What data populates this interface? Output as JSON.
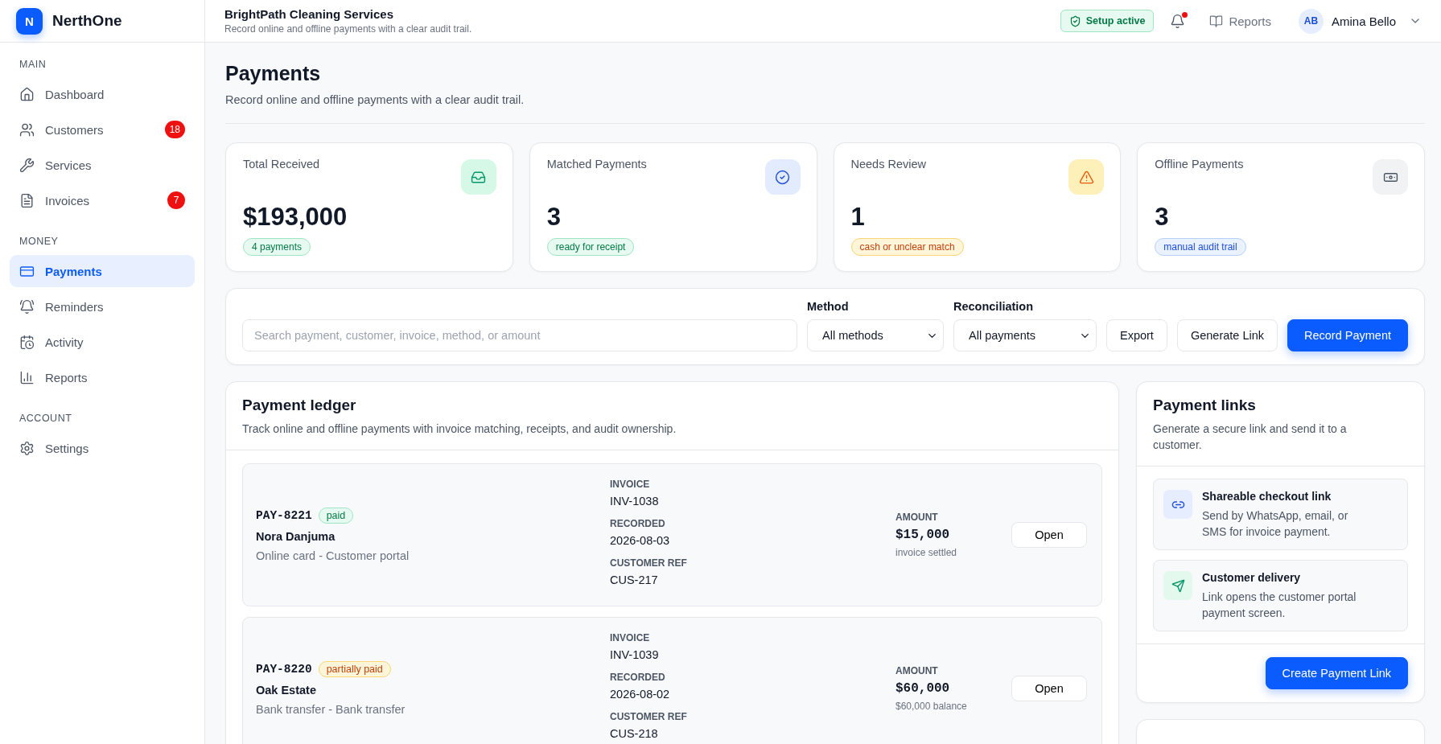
{
  "brand": {
    "logo_letter": "N",
    "name": "NerthOne"
  },
  "sidebar": {
    "sections": [
      {
        "heading": "MAIN",
        "items": [
          {
            "label": "Dashboard",
            "selected": false
          },
          {
            "label": "Customers",
            "badge": "18",
            "selected": false
          },
          {
            "label": "Services",
            "selected": false
          },
          {
            "label": "Invoices",
            "badge": "7",
            "selected": false
          }
        ]
      },
      {
        "heading": "MONEY",
        "items": [
          {
            "label": "Payments",
            "selected": true
          },
          {
            "label": "Reminders",
            "selected": false
          },
          {
            "label": "Activity",
            "selected": false
          },
          {
            "label": "Reports",
            "selected": false
          }
        ]
      },
      {
        "heading": "ACCOUNT",
        "items": [
          {
            "label": "Settings",
            "selected": false
          }
        ]
      }
    ]
  },
  "topbar": {
    "title": "BrightPath Cleaning Services",
    "subtitle": "Record online and offline payments with a clear audit trail.",
    "status_badge": "Setup active",
    "has_unread": true,
    "reports_link": "Reports",
    "user": {
      "initials": "AB",
      "name": "Amina Bello"
    }
  },
  "page": {
    "title": "Payments",
    "subtitle": "Record online and offline payments with a clear audit trail."
  },
  "stats": [
    {
      "label": "Total Received",
      "value": "$193,000",
      "tag": {
        "text": "4 payments",
        "kind": "success"
      }
    },
    {
      "label": "Matched Payments",
      "value": "3",
      "tag": {
        "text": "ready for receipt",
        "kind": "success"
      }
    },
    {
      "label": "Needs Review",
      "value": "1",
      "tag": {
        "text": "cash or unclear match",
        "kind": "warning"
      }
    },
    {
      "label": "Offline Payments",
      "value": "3",
      "tag": {
        "text": "manual audit trail",
        "kind": "info"
      }
    }
  ],
  "filters": {
    "search": {
      "placeholder": "Search payment, customer, invoice, method, or amount"
    },
    "method": {
      "label": "Method",
      "value": "All methods"
    },
    "reconciliation": {
      "label": "Reconciliation",
      "value": "All payments"
    },
    "buttons": [
      {
        "label": "Export",
        "kind": "secondary"
      },
      {
        "label": "Generate Link",
        "kind": "secondary"
      },
      {
        "label": "Record Payment",
        "kind": "primary"
      }
    ]
  },
  "ledger": {
    "title": "Payment ledger",
    "subtitle": "Track online and offline payments with invoice matching, receipts, and audit ownership.",
    "payments": [
      {
        "id": "PAY-8221",
        "status": {
          "text": "paid",
          "kind": "success"
        },
        "customer": "Nora Danjuma",
        "method": "Online card - Customer portal",
        "fields": [
          {
            "label": "INVOICE",
            "value": "INV-1038"
          },
          {
            "label": "RECORDED",
            "value": "2026-08-03"
          },
          {
            "label": "CUSTOMER REF",
            "value": "CUS-217"
          }
        ],
        "amount_label": "AMOUNT",
        "amount": "$15,000",
        "amount_note": "invoice settled",
        "action": "Open"
      },
      {
        "id": "PAY-8220",
        "status": {
          "text": "partially paid",
          "kind": "warning"
        },
        "customer": "Oak Estate",
        "method": "Bank transfer - Bank transfer",
        "fields": [
          {
            "label": "INVOICE",
            "value": "INV-1039"
          },
          {
            "label": "RECORDED",
            "value": "2026-08-02"
          },
          {
            "label": "CUSTOMER REF",
            "value": "CUS-218"
          }
        ],
        "amount_label": "AMOUNT",
        "amount": "$60,000",
        "amount_note": "$60,000 balance",
        "action": "Open"
      }
    ]
  },
  "payment_links": {
    "title": "Payment links",
    "subtitle": "Generate a secure link and send it to a customer.",
    "options": [
      {
        "title": "Shareable checkout link",
        "description": "Send by WhatsApp, email, or SMS for invoice payment."
      },
      {
        "title": "Customer delivery",
        "description": "Link opens the customer portal payment screen."
      }
    ],
    "button": "Create Payment Link"
  }
}
